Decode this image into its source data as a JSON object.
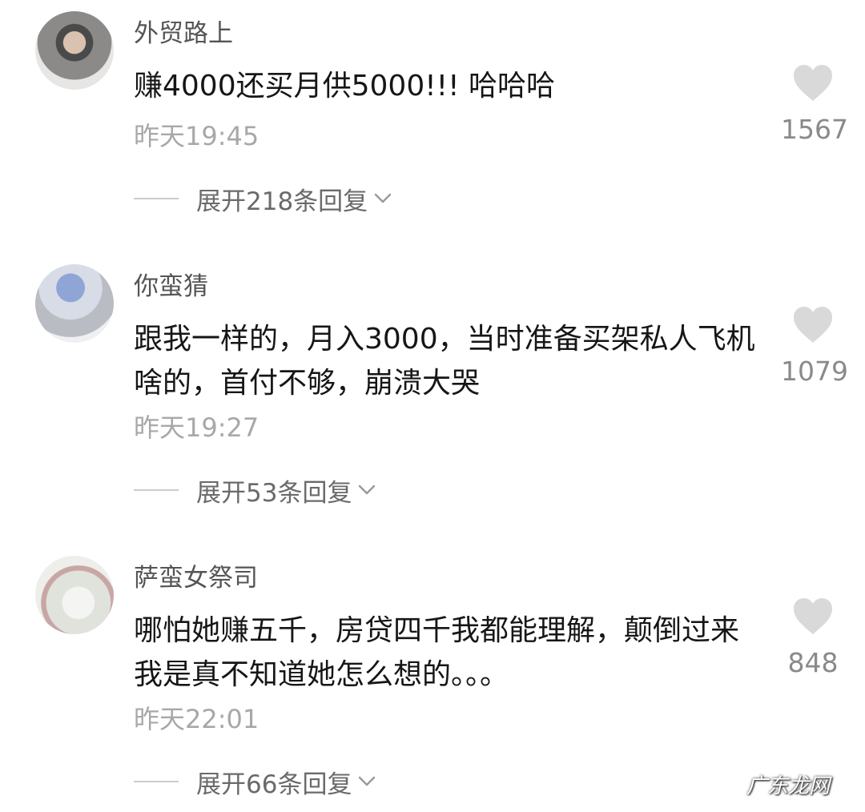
{
  "comments": [
    {
      "username": "外贸路上",
      "text": "赚4000还买月供5000!!! 哈哈哈",
      "time": "昨天19:45",
      "likes": "1567",
      "expand": "展开218条回复"
    },
    {
      "username": "你蛮猜",
      "text": "跟我一样的，月入3000，当时准备买架私人飞机啥的，首付不够，崩溃大哭",
      "time": "昨天19:27",
      "likes": "1079",
      "expand": "展开53条回复"
    },
    {
      "username": "萨蛮女祭司",
      "text": "哪怕她赚五千，房贷四千我都能理解，颠倒过来我是真不知道她怎么想的。。。",
      "time": "昨天22:01",
      "likes": "848",
      "expand": "展开66条回复"
    }
  ],
  "watermark": "广东龙网",
  "colors": {
    "text": "#161616",
    "muted": "#a8a8a8",
    "heart": "#d9d9d9"
  }
}
